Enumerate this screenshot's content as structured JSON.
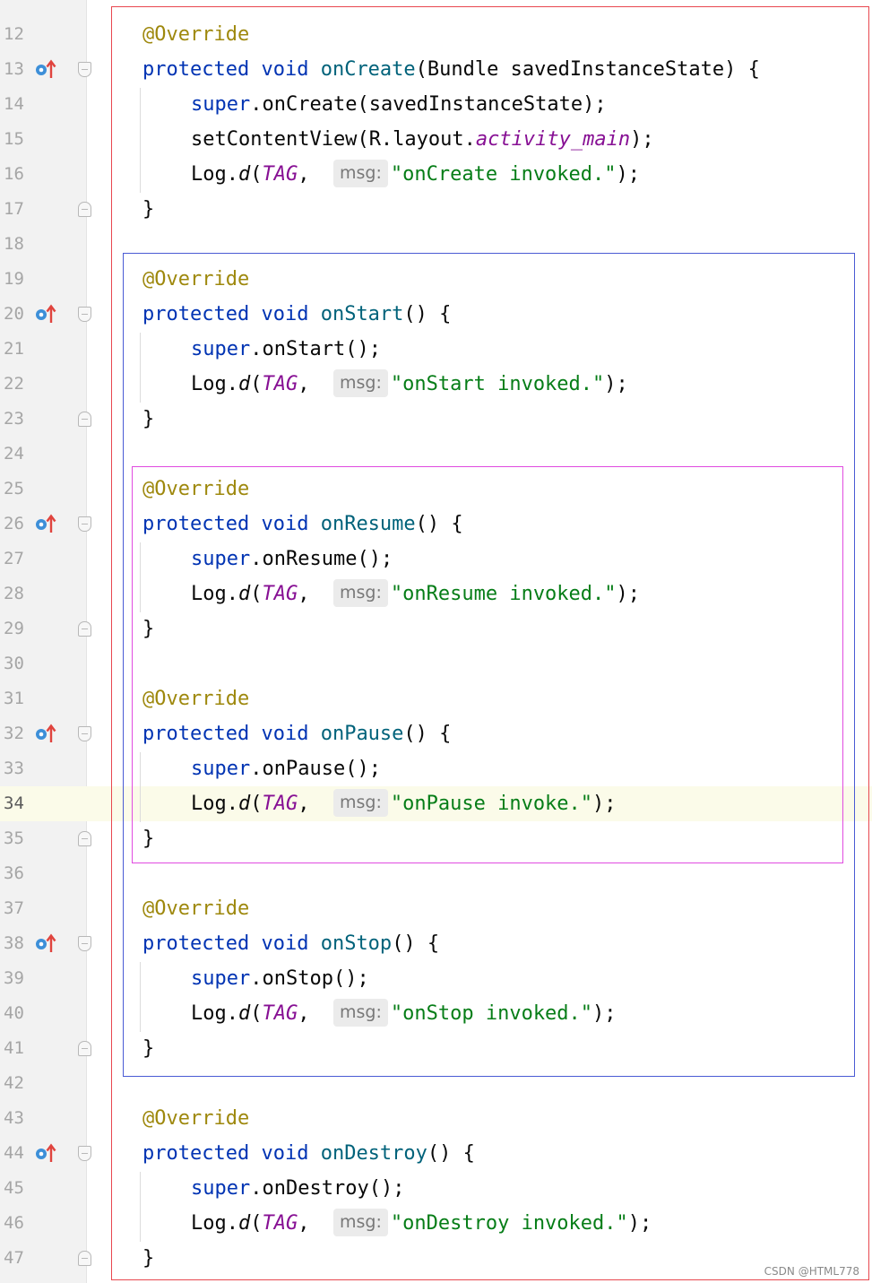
{
  "gutter": {
    "line_numbers": [
      "12",
      "13",
      "14",
      "15",
      "16",
      "17",
      "18",
      "19",
      "20",
      "21",
      "22",
      "23",
      "24",
      "25",
      "26",
      "27",
      "28",
      "29",
      "30",
      "31",
      "32",
      "33",
      "34",
      "35",
      "36",
      "37",
      "38",
      "39",
      "40",
      "41",
      "42",
      "43",
      "44",
      "45",
      "46",
      "47"
    ],
    "current_line": "34",
    "override_marker_icon": "override-method-icon",
    "override_marker_lines": [
      "13",
      "20",
      "26",
      "32",
      "38",
      "44"
    ],
    "fold_icon": "fold-marker-icon"
  },
  "code": {
    "annotation": "@Override",
    "protected_kw": "protected",
    "void_kw": "void",
    "super_kw": "super",
    "set_content_view": "setContentView",
    "log_class": "Log",
    "log_method": "d",
    "tag_const": "TAG",
    "msg_hint": "msg:",
    "r_layout": "R.layout.",
    "layout_name": "activity_main",
    "param_type": "Bundle",
    "param_name": "savedInstanceState",
    "close_brace": "}",
    "methods": {
      "create": {
        "name": "onCreate",
        "message": "\"onCreate invoked.\""
      },
      "start": {
        "name": "onStart",
        "message": "\"onStart invoked.\""
      },
      "resume": {
        "name": "onResume",
        "message": "\"onResume invoked.\""
      },
      "pause": {
        "name": "onPause",
        "message": "\"onPause invoke.\""
      },
      "stop": {
        "name": "onStop",
        "message": "\"onStop invoked.\""
      },
      "destroy": {
        "name": "onDestroy",
        "message": "\"onDestroy invoked.\""
      }
    }
  },
  "highlight_boxes": {
    "outer_color": "#e8474f",
    "middle_color": "#4a5bd4",
    "inner_color": "#e04be0"
  },
  "colors": {
    "annotation": "#9e880d",
    "keyword": "#0033b3",
    "method_name": "#00627a",
    "constant": "#871094",
    "string": "#067d17",
    "current_line_bg": "#fbfbe9"
  },
  "watermark": "CSDN @HTML778"
}
